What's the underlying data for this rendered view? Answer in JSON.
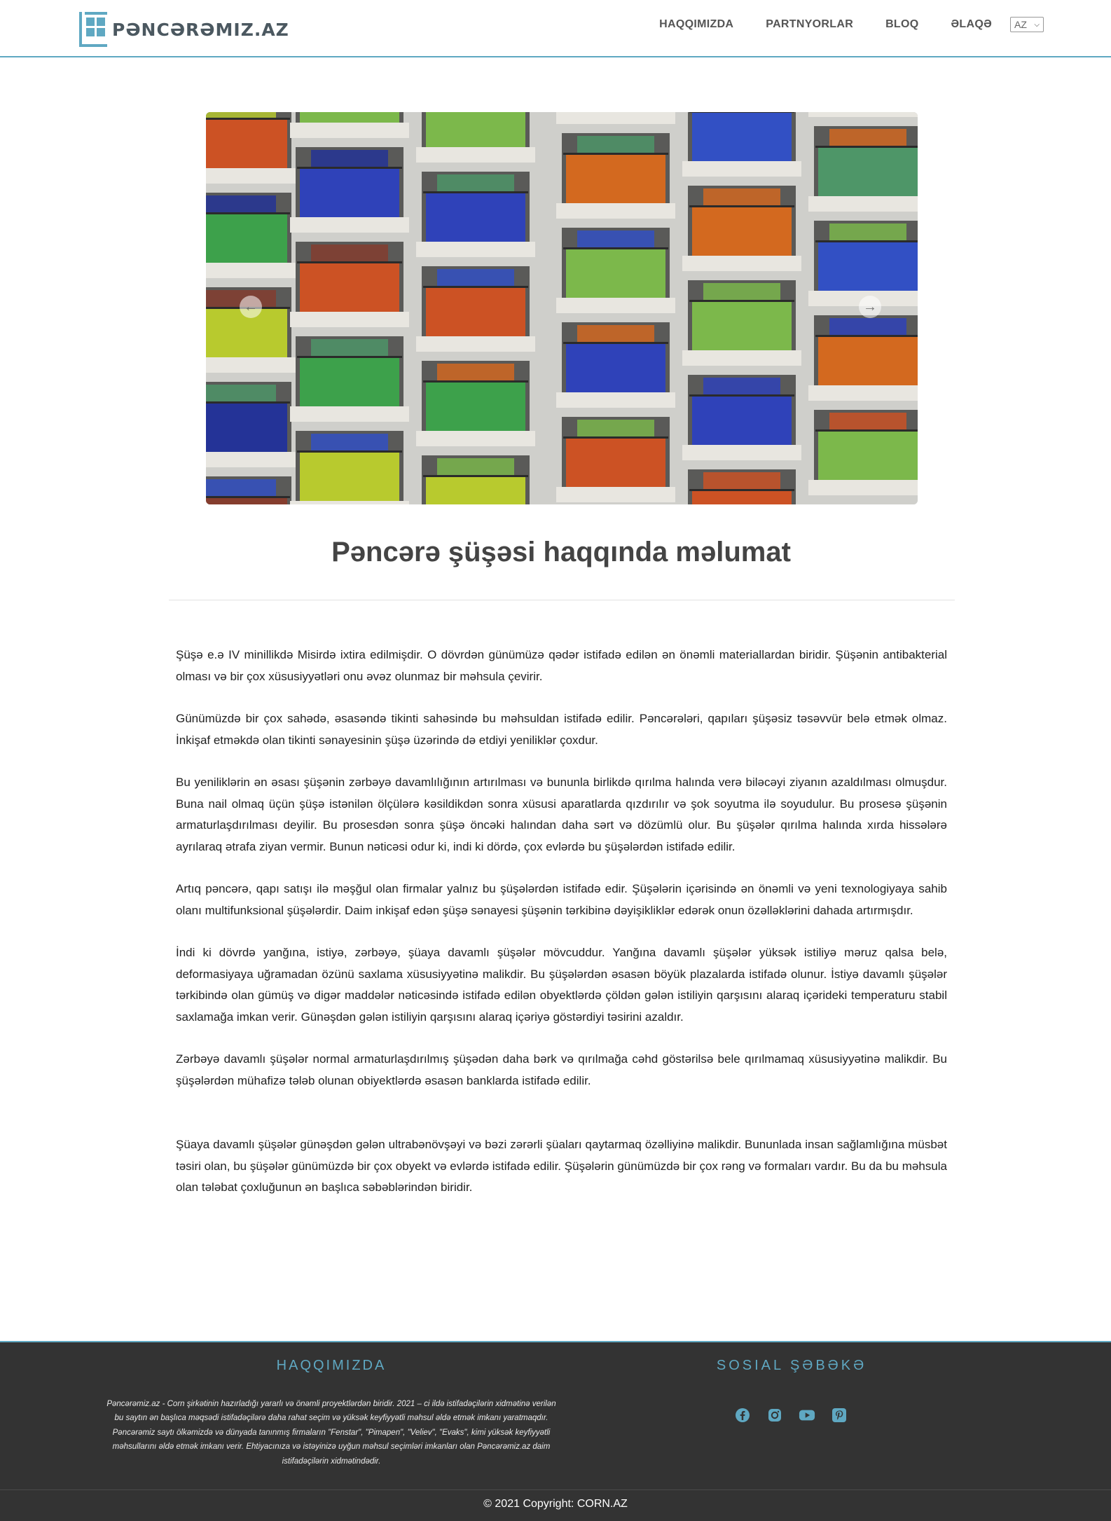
{
  "header": {
    "logo_text": "PƏNCƏRƏMIZ.AZ",
    "nav": [
      "HAQQIMIZDA",
      "PARTNYORLAR",
      "BLOQ",
      "ƏLAQƏ"
    ],
    "language": "AZ"
  },
  "carousel": {
    "prev_icon": "arrow-left-icon",
    "next_icon": "arrow-right-icon"
  },
  "article": {
    "title": "Pəncərə şüşəsi haqqında məlumat",
    "paragraphs": [
      "Şüşə e.ə IV minillikdə Misirdə ixtira edilmişdir. O dövrdən günümüzə qədər istifadə edilən ən önəmli materiallardan biridir. Şüşənin antibakterial olması və bir çox xüsusiyyətləri onu əvəz olunmaz bir məhsula çevirir.",
      "Günümüzdə bir çox sahədə, əsasəndə tikinti sahəsində bu məhsuldan istifadə edilir. Pəncərələri, qapıları şüşəsiz təsəvvür belə etmək olmaz. İnkişaf etməkdə olan tikinti sənayesinin şüşə üzərində də etdiyi yeniliklər çoxdur.",
      "Bu yeniliklərin ən əsası şüşənin zərbəyə davamlılığının artırılması və bununla birlikdə qırılma halında verə biləcəyi ziyanın azaldılması olmuşdur. Buna nail olmaq üçün şüşə istənilən ölçülərə kəsildikdən sonra xüsusi aparatlarda qızdırılır və şok soyutma ilə soyudulur. Bu prosesə şüşənin armaturlaşdırılması deyilir. Bu prosesdən sonra şüşə öncəki halından daha sərt və dözümlü olur. Bu şüşələr qırılma halında xırda hissələrə ayrılaraq ətrafa ziyan vermir. Bunun nəticəsi odur ki, indi ki dördə, çox evlərdə bu şüşələrdən istifadə edilir.",
      "Artıq pəncərə, qapı satışı ilə məşğul olan firmalar yalnız bu şüşələrdən istifadə edir. Şüşələrin içərisində ən önəmli və yeni texnologiyaya sahib olanı multifunksional şüşələrdir. Daim inkişaf edən şüşə sənayesi şüşənin tərkibinə dəyişikliklər edərək onun özəlləklərini dahada artırmışdır.",
      "İndi ki dövrdə yanğına, istiyə, zərbəyə, şüaya davamlı şüşələr mövcuddur. Yanğına davamlı şüşələr yüksək istiliyə məruz qalsa belə, deformasiyaya uğramadan özünü saxlama xüsusiyyətinə malikdir. Bu şüşələrdən əsasən böyük plazalarda istifadə olunur. İstiyə davamlı şüşələr tərkibində olan gümüş və digər maddələr nəticəsində istifadə edilən obyektlərdə çöldən gələn istiliyin qarşısını alaraq içərideki temperaturu stabil saxlamağa imkan verir. Günəşdən gələn istiliyin qarşısını alaraq içəriyə göstərdiyi təsirini azaldır.",
      "Zərbəyə davamlı şüşələr normal armaturlaşdırılmış şüşədən daha bərk və qırılmağa cəhd göstərilsə bele qırılmamaq xüsusiyyətinə malikdir. Bu şüşələrdən mühafizə tələb olunan obiyektlərdə əsasən banklarda istifadə edilir.",
      "Şüaya davamlı şüşələr günəşdən gələn ultrabənövşəyi və bəzi zərərli şüaları qaytarmaq özəlliyinə malikdir. Bununlada insan sağlamlığına müsbət təsiri olan, bu şüşələr günümüzdə bir çox obyekt və evlərdə istifadə edilir. Şüşələrin günümüzdə bir çox rəng və formaları vardır. Bu da bu məhsula olan tələbat çoxluğunun ən başlıca səbəblərindən biridir."
    ]
  },
  "footer": {
    "about_title": "HAQQIMIZDA",
    "about_line1": "Pəncərəmiz.az - Corn şirkətinin hazırladığı yararlı və önəmli proyektlərdən biridir. 2021 – ci ildə istifadəçilərin xidmətinə verilən bu saytın ən başlıca məqsədi istifadəçilərə daha rahat seçim və yüksək keyfiyyətli məhsul əldə etmək imkanı yaratmaqdır.",
    "about_line2": "Pəncərəmiz saytı ölkəmizdə və dünyada tanınmış firmaların \"Fenstar\", \"Pimapen\", \"Veliev\", \"Evaks\",  kimi yüksək keyfiyyətli məhsullarını əldə etmək imkanı verir. Ehtiyacınıza və istəyinizə uyğun məhsul seçimləri imkanları olan Pəncərəmiz.az daim istifadəçilərin xidmətindədir.",
    "social_title": "SOSIAL ŞƏBƏKƏ",
    "social_icons": [
      "facebook-icon",
      "instagram-icon",
      "youtube-icon",
      "pinterest-icon"
    ],
    "copyright": "© 2021 Copyright: CORN.AZ"
  },
  "colors": {
    "accent": "#5fa8c2",
    "footer_bg": "#333333"
  }
}
